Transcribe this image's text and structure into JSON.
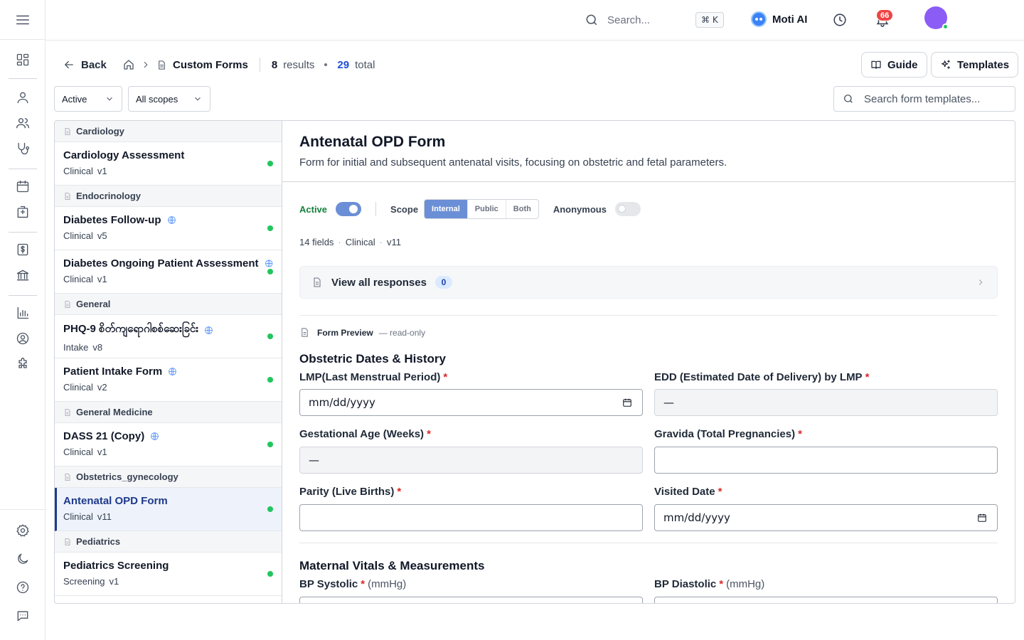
{
  "topbar": {
    "search_placeholder": "Search...",
    "shortcut": "⌘ K",
    "assistant_label": "Moti AI",
    "notification_count": "66"
  },
  "header": {
    "back_label": "Back",
    "breadcrumb_title": "Custom Forms",
    "results_count": "8",
    "results_label": "results",
    "total_count": "29",
    "total_label": "total",
    "guide_label": "Guide",
    "templates_label": "Templates"
  },
  "filters": {
    "status_value": "Active",
    "scope_value": "All scopes",
    "search_placeholder": "Search form templates..."
  },
  "list": {
    "groups": [
      {
        "name": "Cardiology",
        "items": [
          {
            "name": "Cardiology Assessment",
            "category": "Clinical",
            "version": "v1",
            "public": false
          }
        ]
      },
      {
        "name": "Endocrinology",
        "items": [
          {
            "name": "Diabetes Follow-up",
            "category": "Clinical",
            "version": "v5",
            "public": true
          },
          {
            "name": "Diabetes Ongoing Patient Assessment",
            "category": "Clinical",
            "version": "v1",
            "public": true
          }
        ]
      },
      {
        "name": "General",
        "items": [
          {
            "name": "PHQ-9 စိတ်ကျရောဂါစစ်ဆေးခြင်း",
            "category": "Intake",
            "version": "v8",
            "public": true
          },
          {
            "name": "Patient Intake Form",
            "category": "Clinical",
            "version": "v2",
            "public": true
          }
        ]
      },
      {
        "name": "General Medicine",
        "items": [
          {
            "name": "DASS 21 (Copy)",
            "category": "Clinical",
            "version": "v1",
            "public": true
          }
        ]
      },
      {
        "name": "Obstetrics_gynecology",
        "items": [
          {
            "name": "Antenatal OPD Form",
            "category": "Clinical",
            "version": "v11",
            "public": false,
            "selected": true
          }
        ]
      },
      {
        "name": "Pediatrics",
        "items": [
          {
            "name": "Pediatrics Screening",
            "category": "Screening",
            "version": "v1",
            "public": false
          }
        ]
      }
    ]
  },
  "detail": {
    "title": "Antenatal OPD Form",
    "description": "Form for initial and subsequent antenatal visits, focusing on obstetric and fetal parameters.",
    "active_label": "Active",
    "scope_label": "Scope",
    "scope_options": [
      "Internal",
      "Public",
      "Both"
    ],
    "scope_selected": "Internal",
    "anonymous_label": "Anonymous",
    "fields_count": "14 fields",
    "category": "Clinical",
    "version": "v11",
    "responses_label": "View all responses",
    "responses_count": "0",
    "preview_label": "Form Preview",
    "preview_note": "— read-only"
  },
  "form": {
    "section1": "Obstetric Dates & History",
    "lmp_label": "LMP(Last Menstrual Period)",
    "lmp_value": "mm/dd/yyyy",
    "edd_label": "EDD (Estimated Date of Delivery) by LMP",
    "edd_value": "—",
    "ga_label": "Gestational Age (Weeks)",
    "ga_value": "—",
    "gravida_label": "Gravida (Total Pregnancies)",
    "parity_label": "Parity (Live Births)",
    "visited_label": "Visited Date",
    "visited_value": "mm/dd/yyyy",
    "required_mark": "*",
    "section2": "Maternal Vitals & Measurements",
    "bp_sys_label": "BP Systolic",
    "bp_dia_label": "BP Diastolic",
    "bp_unit": "(mmHg)"
  }
}
